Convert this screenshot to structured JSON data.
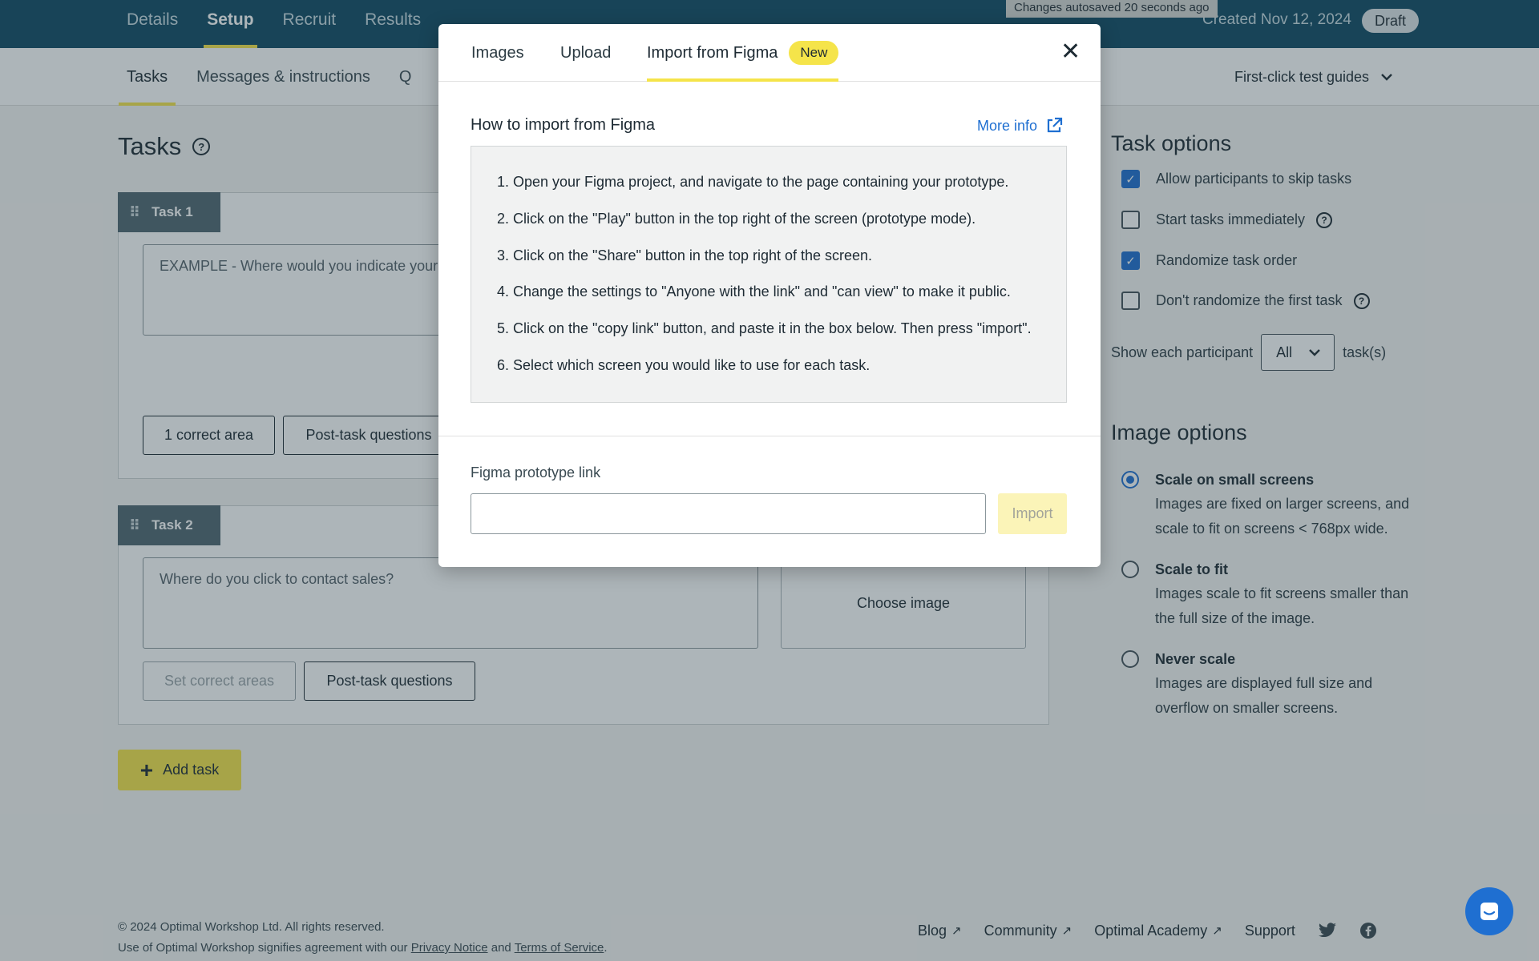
{
  "topnav": {
    "items": [
      {
        "label": "Details"
      },
      {
        "label": "Setup",
        "active": true
      },
      {
        "label": "Recruit"
      },
      {
        "label": "Results"
      }
    ],
    "autosave": "Changes autosaved 20 seconds ago",
    "created": "Created Nov 12, 2024",
    "status": "Draft"
  },
  "subnav": {
    "items": [
      {
        "label": "Tasks",
        "active": true
      },
      {
        "label": "Messages & instructions"
      },
      {
        "label": "Q"
      }
    ],
    "guides": "First-click test guides"
  },
  "main": {
    "title": "Tasks",
    "tasks": [
      {
        "label": "Task 1",
        "text": "EXAMPLE - Where would you indicate your",
        "correct_area": "1 correct area",
        "post_task": "Post-task questions"
      },
      {
        "label": "Task 2",
        "text": "Where do you click to contact sales?",
        "correct_area": "Set correct areas",
        "post_task": "Post-task questions",
        "choose_image": "Choose image"
      }
    ],
    "add_task": "Add task"
  },
  "task_options": {
    "heading": "Task options",
    "checks": [
      {
        "label": "Allow participants to skip tasks",
        "checked": true
      },
      {
        "label": "Start tasks immediately",
        "checked": false
      },
      {
        "label": "Randomize task order",
        "checked": true
      },
      {
        "label": "Don't randomize the first task",
        "checked": false
      }
    ],
    "show_each": "Show each participant",
    "select_value": "All",
    "tasks_suffix": "task(s)"
  },
  "image_options": {
    "heading": "Image options",
    "radios": [
      {
        "title": "Scale on small screens",
        "desc": "Images are fixed on larger screens, and scale to fit on screens < 768px wide.",
        "checked": true
      },
      {
        "title": "Scale to fit",
        "desc": "Images scale to fit screens smaller than the full size of the image.",
        "checked": false
      },
      {
        "title": "Never scale",
        "desc": "Images are displayed full size and overflow on smaller screens.",
        "checked": false
      }
    ]
  },
  "footer": {
    "copyright": "© 2024 Optimal Workshop Ltd. All rights reserved.",
    "agreement_prefix": "Use of Optimal Workshop signifies agreement with our",
    "privacy": "Privacy Notice",
    "and": "and",
    "terms": "Terms of Service",
    "period": ".",
    "links": [
      {
        "label": "Blog"
      },
      {
        "label": "Community"
      },
      {
        "label": "Optimal Academy"
      },
      {
        "label": "Support"
      }
    ]
  },
  "modal": {
    "tabs": [
      {
        "label": "Images"
      },
      {
        "label": "Upload"
      },
      {
        "label": "Import from Figma",
        "active": true,
        "badge": "New"
      }
    ],
    "how_title": "How to import from Figma",
    "more_info": "More info",
    "steps": [
      "Open your Figma project, and navigate to the page containing your prototype.",
      "Click on the \"Play\" button in the top right of the screen (prototype mode).",
      "Click on the \"Share\" button in the top right of the screen.",
      "Change the settings to \"Anyone with the link\" and \"can view\" to make it public.",
      "Click on the \"copy link\" button, and paste it in the box below. Then press \"import\".",
      "Select which screen you would like to use for each task."
    ],
    "link_label": "Figma prototype link",
    "link_value": "",
    "import_label": "Import"
  },
  "colors": {
    "nav_bg": "#0f4a63",
    "accent_yellow": "#f5e44a",
    "link_blue": "#1f6fd1"
  }
}
